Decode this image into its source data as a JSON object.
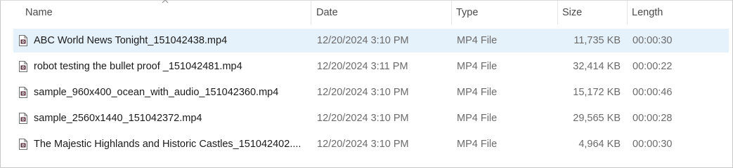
{
  "columns": {
    "name": "Name",
    "date": "Date",
    "type": "Type",
    "size": "Size",
    "length": "Length"
  },
  "files": [
    {
      "name": "ABC World News Tonight_151042438.mp4",
      "date": "12/20/2024 3:10 PM",
      "type": "MP4 File",
      "size": "11,735 KB",
      "length": "00:00:30",
      "selected": true,
      "icon": "video-file-icon"
    },
    {
      "name": "robot testing the bullet proof _151042481.mp4",
      "date": "12/20/2024 3:11 PM",
      "type": "MP4 File",
      "size": "32,414 KB",
      "length": "00:00:22",
      "selected": false,
      "icon": "video-file-icon"
    },
    {
      "name": "sample_960x400_ocean_with_audio_151042360.mp4",
      "date": "12/20/2024 3:10 PM",
      "type": "MP4 File",
      "size": "15,172 KB",
      "length": "00:00:46",
      "selected": false,
      "icon": "video-file-icon"
    },
    {
      "name": "sample_2560x1440_151042372.mp4",
      "date": "12/20/2024 3:10 PM",
      "type": "MP4 File",
      "size": "29,565 KB",
      "length": "00:00:28",
      "selected": false,
      "icon": "video-file-icon"
    },
    {
      "name": "The Majestic Highlands and Historic Castles_151042402....",
      "date": "12/20/2024 3:10 PM",
      "type": "MP4 File",
      "size": "4,964 KB",
      "length": "00:00:30",
      "selected": false,
      "icon": "video-file-icon"
    }
  ],
  "colors": {
    "selection": "#e5f1fb",
    "header_text": "#4a4a4a",
    "secondary_text": "#6b6b6b"
  }
}
